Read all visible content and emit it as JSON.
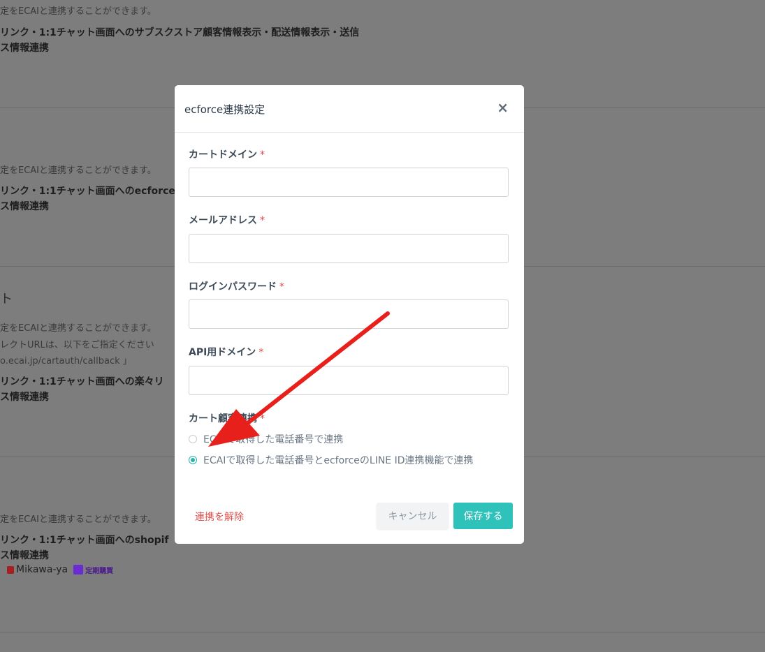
{
  "background": {
    "section1": {
      "desc": "定をECAIと連携することができます。",
      "bold1": "リンク・1:1チャット画面へのサブスクストア顧客情報表示・配送情報表示・送信",
      "bold2": "ス情報連携"
    },
    "section2": {
      "desc": "定をECAIと連携することができます。",
      "bold1": "リンク・1:1チャット画面へのecforce",
      "bold2": "ス情報連携"
    },
    "section3": {
      "title": "ト",
      "desc1": "定をECAIと連携することができます。",
      "desc2": "レクトURLは、以下をご指定ください",
      "desc3": "o.ecai.jp/cartauth/callback 」",
      "bold1": "リンク・1:1チャット画面への楽々リ",
      "bold2": "ス情報連携"
    },
    "section4": {
      "desc": "定をECAIと連携することができます。",
      "bold1": "リンク・1:1チャット画面へのshopif",
      "bold2": "ス情報連携",
      "logo1": "Mikawa-ya",
      "logo2": "定期購買"
    }
  },
  "modal": {
    "title": "ecforce連携設定",
    "close_icon": "×",
    "required_mark": "*",
    "fields": [
      {
        "label": "カートドメイン",
        "value": ""
      },
      {
        "label": "メールアドレス",
        "value": ""
      },
      {
        "label": "ログインパスワード",
        "value": ""
      },
      {
        "label": "API用ドメイン",
        "value": ""
      }
    ],
    "radio_group_label": "カート顧客連携",
    "radio_options": [
      {
        "label": "ECAIで取得した電話番号で連携",
        "selected": false
      },
      {
        "label": "ECAIで取得した電話番号とecforceのLINE ID連携機能で連携",
        "selected": true
      }
    ],
    "unlink_label": "連携を解除",
    "cancel_label": "キャンセル",
    "save_label": "保存する"
  },
  "colors": {
    "overlay": "#7d7d7d",
    "accent": "#2ec2ba",
    "danger": "#e0504d",
    "arrow": "#e8201c"
  }
}
